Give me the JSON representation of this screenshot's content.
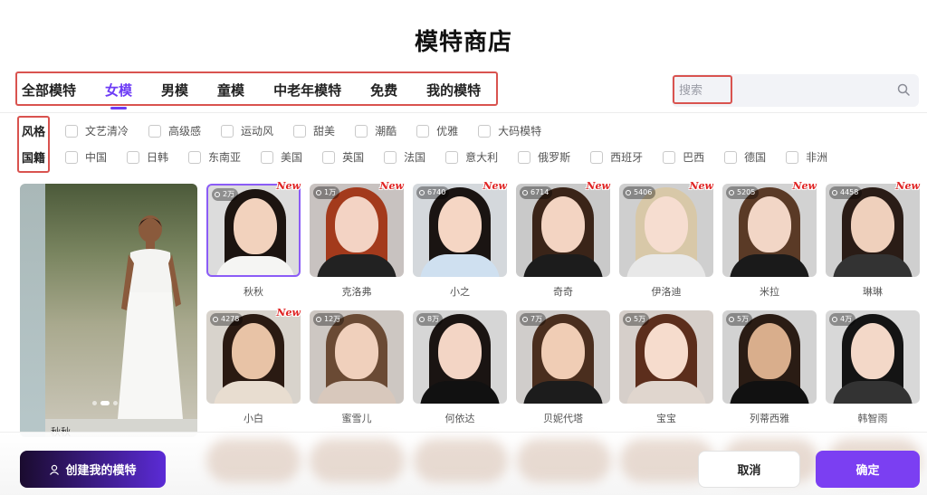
{
  "page_title": "模特商店",
  "tabs": [
    {
      "label": "全部模特",
      "active": false
    },
    {
      "label": "女模",
      "active": true
    },
    {
      "label": "男模",
      "active": false
    },
    {
      "label": "童模",
      "active": false
    },
    {
      "label": "中老年模特",
      "active": false
    },
    {
      "label": "免费",
      "active": false
    },
    {
      "label": "我的模特",
      "active": false
    }
  ],
  "search": {
    "placeholder": "搜索"
  },
  "filters": {
    "style": {
      "label": "风格",
      "options": [
        "文艺清冷",
        "高级感",
        "运动风",
        "甜美",
        "潮酷",
        "优雅",
        "大码模特"
      ]
    },
    "nationality": {
      "label": "国籍",
      "options": [
        "中国",
        "日韩",
        "东南亚",
        "美国",
        "英国",
        "法国",
        "意大利",
        "俄罗斯",
        "西班牙",
        "巴西",
        "德国",
        "非洲"
      ]
    }
  },
  "featured": {
    "caption": "秋秋",
    "active_slide": 2,
    "slide_count": 3
  },
  "models": [
    {
      "name": "秋秋",
      "views": "2万",
      "is_new": true,
      "selected": true
    },
    {
      "name": "克洛弗",
      "views": "1万",
      "is_new": true,
      "selected": false
    },
    {
      "name": "小之",
      "views": "6740",
      "is_new": true,
      "selected": false
    },
    {
      "name": "奇奇",
      "views": "6714",
      "is_new": true,
      "selected": false
    },
    {
      "name": "伊洛迪",
      "views": "5406",
      "is_new": true,
      "selected": false
    },
    {
      "name": "米拉",
      "views": "5205",
      "is_new": true,
      "selected": false
    },
    {
      "name": "琳琳",
      "views": "4458",
      "is_new": true,
      "selected": false
    },
    {
      "name": "小白",
      "views": "4278",
      "is_new": true,
      "selected": false
    },
    {
      "name": "蜜雪儿",
      "views": "12万",
      "is_new": false,
      "selected": false
    },
    {
      "name": "何依达",
      "views": "8万",
      "is_new": false,
      "selected": false
    },
    {
      "name": "贝妮代塔",
      "views": "7万",
      "is_new": false,
      "selected": false
    },
    {
      "name": "宝宝",
      "views": "5万",
      "is_new": false,
      "selected": false
    },
    {
      "name": "列蒂西雅",
      "views": "5万",
      "is_new": false,
      "selected": false
    },
    {
      "name": "韩智雨",
      "views": "4万",
      "is_new": false,
      "selected": false
    }
  ],
  "new_tag": "New",
  "buttons": {
    "create": "创建我的模特",
    "cancel": "取消",
    "confirm": "确定"
  },
  "colors": {
    "accent": "#7b3ff2",
    "highlight_box": "#d9534f",
    "new_tag": "#e02424"
  }
}
